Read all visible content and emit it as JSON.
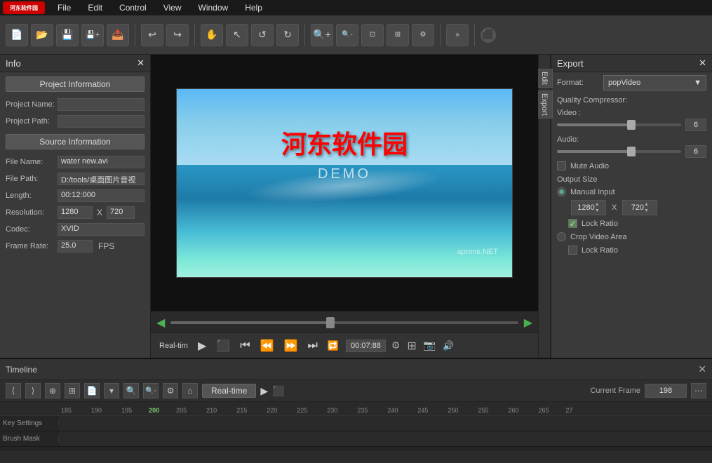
{
  "menubar": {
    "logo": "河东软件园",
    "menus": [
      "File",
      "Edit",
      "Control",
      "View",
      "Window",
      "Help"
    ]
  },
  "toolbar": {
    "buttons": [
      "new",
      "open",
      "save",
      "save-as",
      "export-file",
      "undo",
      "redo",
      "hand",
      "pointer",
      "rotate-left",
      "rotate-right",
      "zoom-in",
      "zoom-out",
      "zoom-fit",
      "zoom-actual",
      "zoom-options",
      "more",
      "render"
    ]
  },
  "info_panel": {
    "title": "Info",
    "project_section": "Project Information",
    "project_name_label": "Project Name:",
    "project_name_value": "",
    "project_path_label": "Project Path:",
    "project_path_value": "",
    "source_section": "Source Information",
    "file_name_label": "File Name:",
    "file_name_value": "water  new.avi",
    "file_path_label": "File Path:",
    "file_path_value": "D:/tools/桌面图片音视",
    "length_label": "Length:",
    "length_value": "00:12:000",
    "resolution_label": "Resolution:",
    "resolution_w": "1280",
    "resolution_x": "X",
    "resolution_h": "720",
    "codec_label": "Codec:",
    "codec_value": "XVID",
    "framerate_label": "Frame Rate:",
    "framerate_value": "25.0",
    "framerate_unit": "FPS"
  },
  "video": {
    "main_text": "河东软件园",
    "sub_text": "DEMO",
    "watermark": "aprons.NET"
  },
  "playback": {
    "realtime_label": "Real-tim",
    "time_display": "00:07:88",
    "current_frame_label": "Current Frame"
  },
  "export_panel": {
    "title": "Export",
    "format_label": "Format:",
    "format_value": "popVideo",
    "quality_label": "Quality Compressor:",
    "video_label": "Video :",
    "video_value": "6",
    "audio_label": "Audio:",
    "audio_value": "6",
    "mute_audio_label": "Mute Audio",
    "output_size_label": "Output Size",
    "manual_input_label": "Manual Input",
    "width_value": "1280",
    "height_value": "720",
    "lock_ratio_label": "Lock Ratio",
    "crop_video_label": "Crop Video Area",
    "loc_ratio_label": "Lock Ratio"
  },
  "timeline": {
    "title": "Timeline",
    "realtime_btn": "Real-time",
    "current_frame_label": "Current Frame",
    "frame_value": "198",
    "ruler_ticks": [
      "185",
      "190",
      "195",
      "200",
      "205",
      "210",
      "215",
      "220",
      "225",
      "230",
      "235",
      "240",
      "245",
      "250",
      "255",
      "260",
      "265",
      "27"
    ],
    "tracks": [
      {
        "label": "Key Settings"
      },
      {
        "label": "Brush Mask"
      }
    ]
  }
}
